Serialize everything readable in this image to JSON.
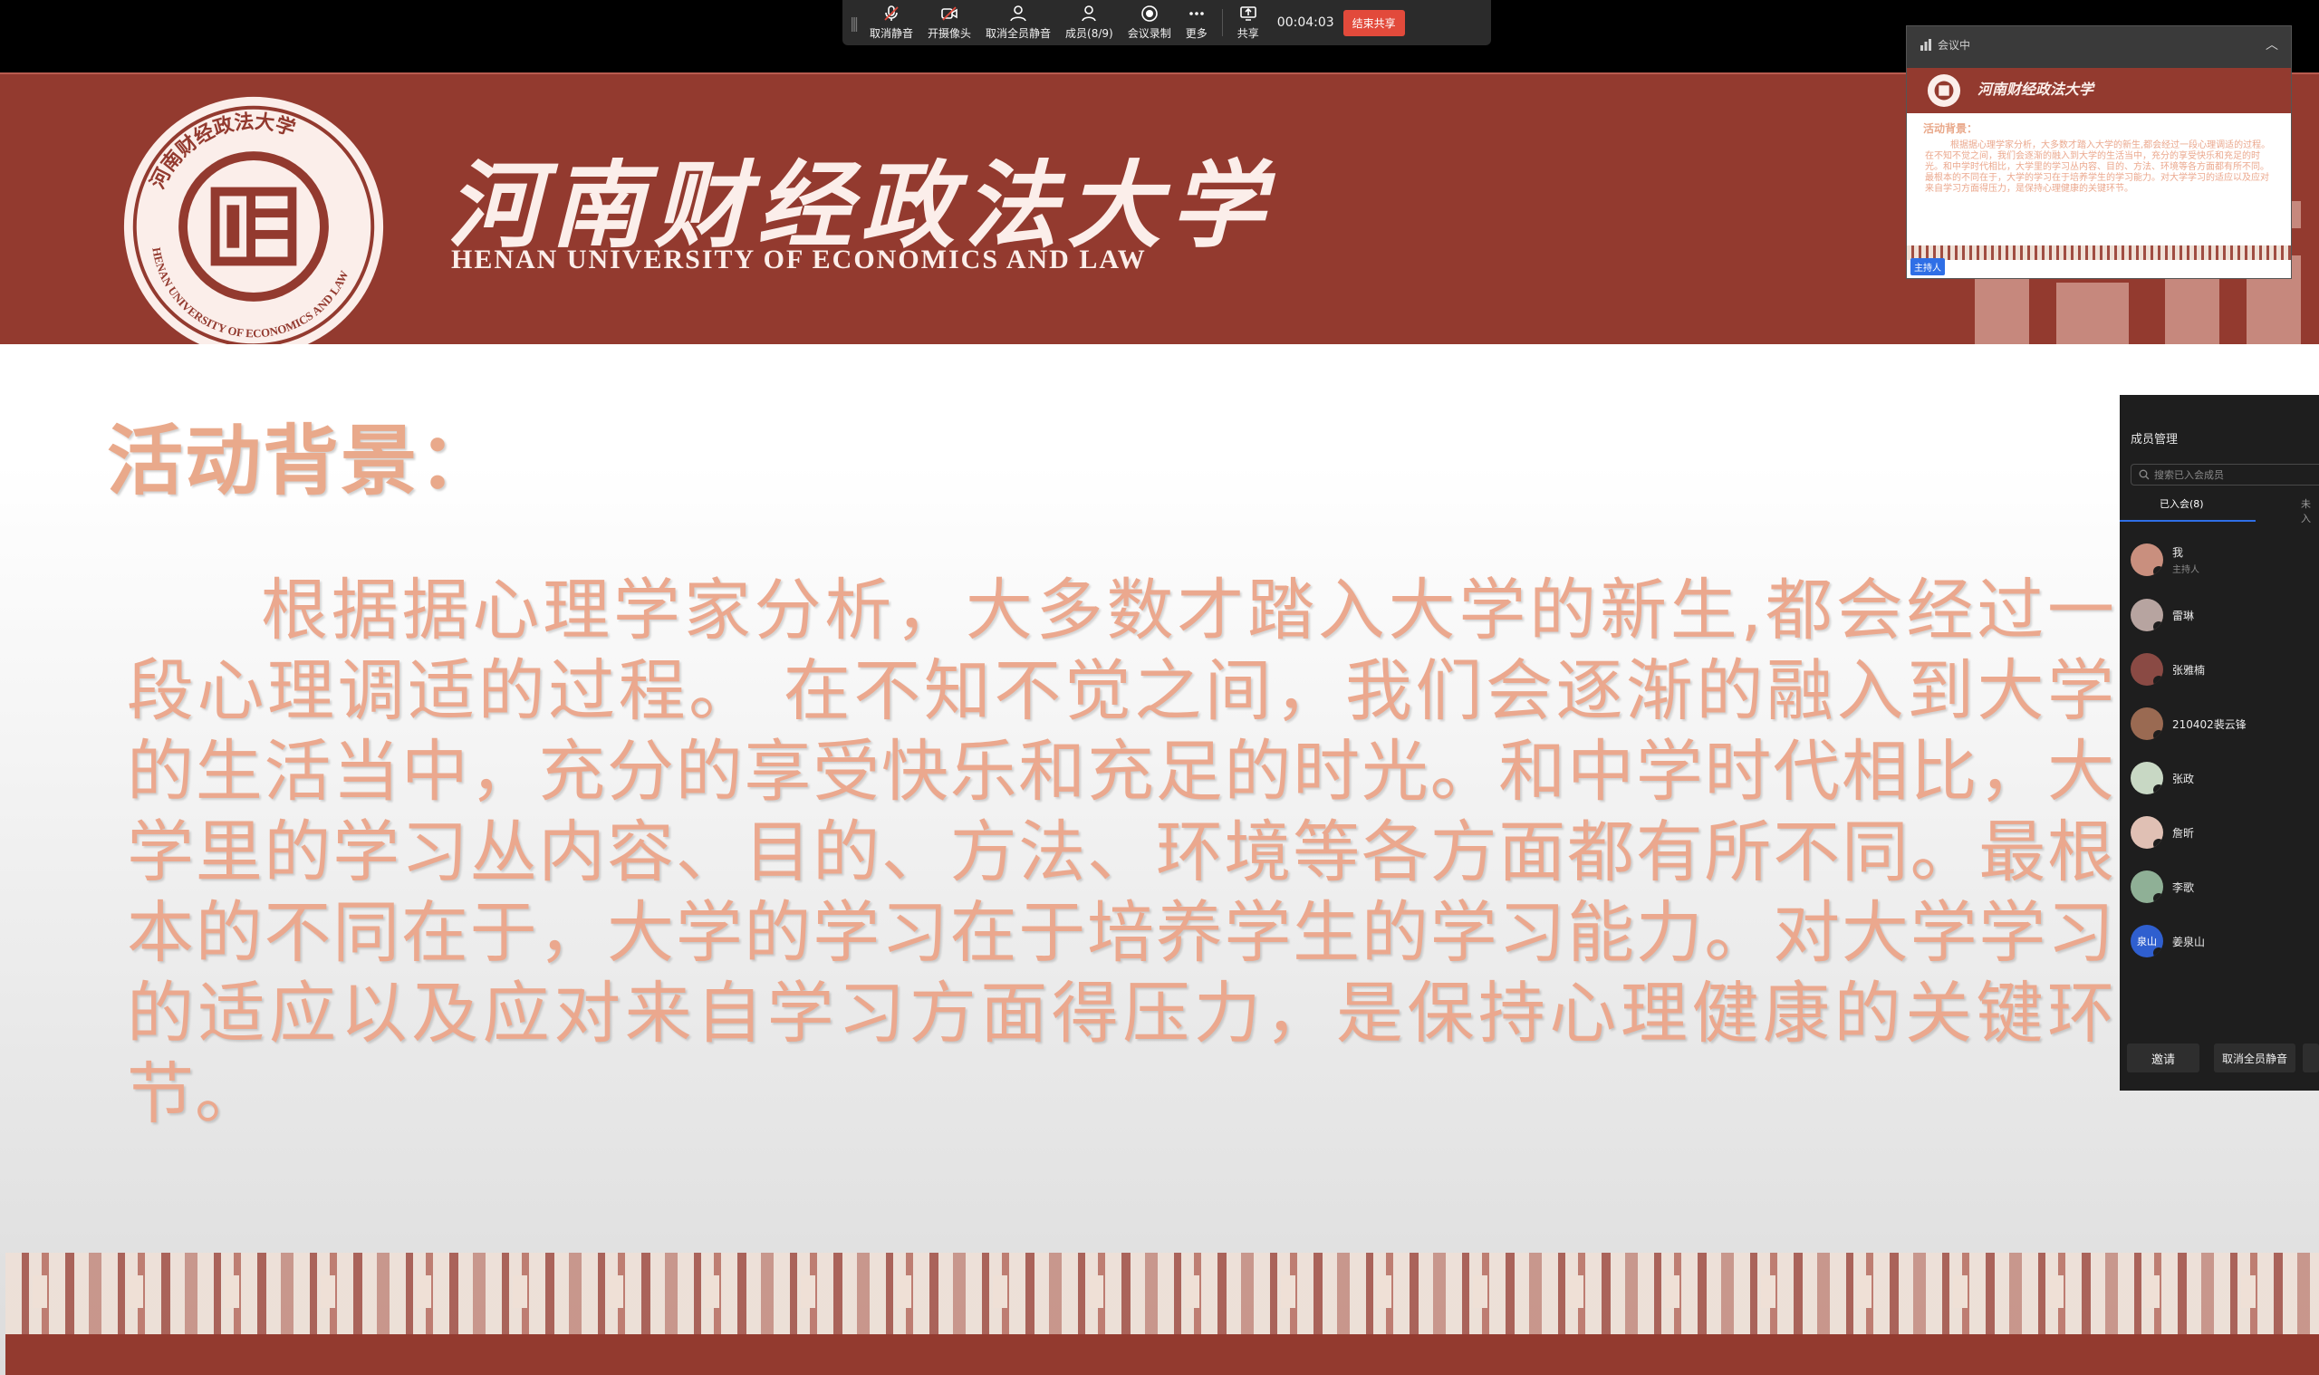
{
  "toolbar": {
    "buttons": [
      {
        "label": "取消静音",
        "icon": "microphone-icon"
      },
      {
        "label": "开摄像头",
        "icon": "camera-off-icon"
      },
      {
        "label": "取消全员静音",
        "icon": "mute-all-icon"
      },
      {
        "label": "成员(8/9)",
        "icon": "members-icon"
      },
      {
        "label": "会议录制",
        "icon": "record-icon"
      },
      {
        "label": "更多",
        "icon": "more-icon"
      },
      {
        "label": "共享",
        "icon": "share-screen-icon"
      }
    ],
    "timer": "00:04:03",
    "end_share": "结束共享"
  },
  "slide": {
    "university_cn": "河南财经政法大学",
    "university_en": "HENAN UNIVERSITY OF ECONOMICS AND LAW",
    "seal_text": "HENAN UNIVERSITY OF ECONOMICS AND LAW",
    "seal_text_cn": "河南财经政法大学",
    "title": "活动背景：",
    "body": "根据据心理学家分析，大多数才踏入大学的新生,都会经过一段心理调适的过程。 在不知不觉之间，我们会逐渐的融入到大学的生活当中，充分的享受快乐和充足的时光。和中学时代相比，大学里的学习丛内容、目的、方法、环境等各方面都有所不同。最根本的不同在于，大学的学习在于培养学生的学习能力。对大学学习的适应以及应对来自学习方面得压力，是保持心理健康的关键环节。"
  },
  "thumbnail": {
    "status": "会议中",
    "host_tag": "主持人",
    "self_label": "我"
  },
  "panel": {
    "title": "成员管理",
    "search_placeholder": "搜索已入会成员",
    "tab_joined": "已入会(8)",
    "tab_not_joined": "未入",
    "members": [
      {
        "name": "我",
        "role": "主持人",
        "color": "#c98f7e"
      },
      {
        "name": "雷琳",
        "role": "",
        "color": "#b7a4a0"
      },
      {
        "name": "张雅楠",
        "role": "",
        "color": "#8a4a44"
      },
      {
        "name": "210402裴云锋",
        "role": "",
        "color": "#9a6a52"
      },
      {
        "name": "张政",
        "role": "",
        "color": "#c8d8c4"
      },
      {
        "name": "詹昕",
        "role": "",
        "color": "#e0c0b4"
      },
      {
        "name": "李歌",
        "role": "",
        "color": "#8fb096"
      },
      {
        "name": "姜泉山",
        "role": "",
        "color": "#2f5fcf",
        "avatar_text": "泉山"
      }
    ],
    "invite": "邀请",
    "mute_all": "取消全员静音"
  }
}
